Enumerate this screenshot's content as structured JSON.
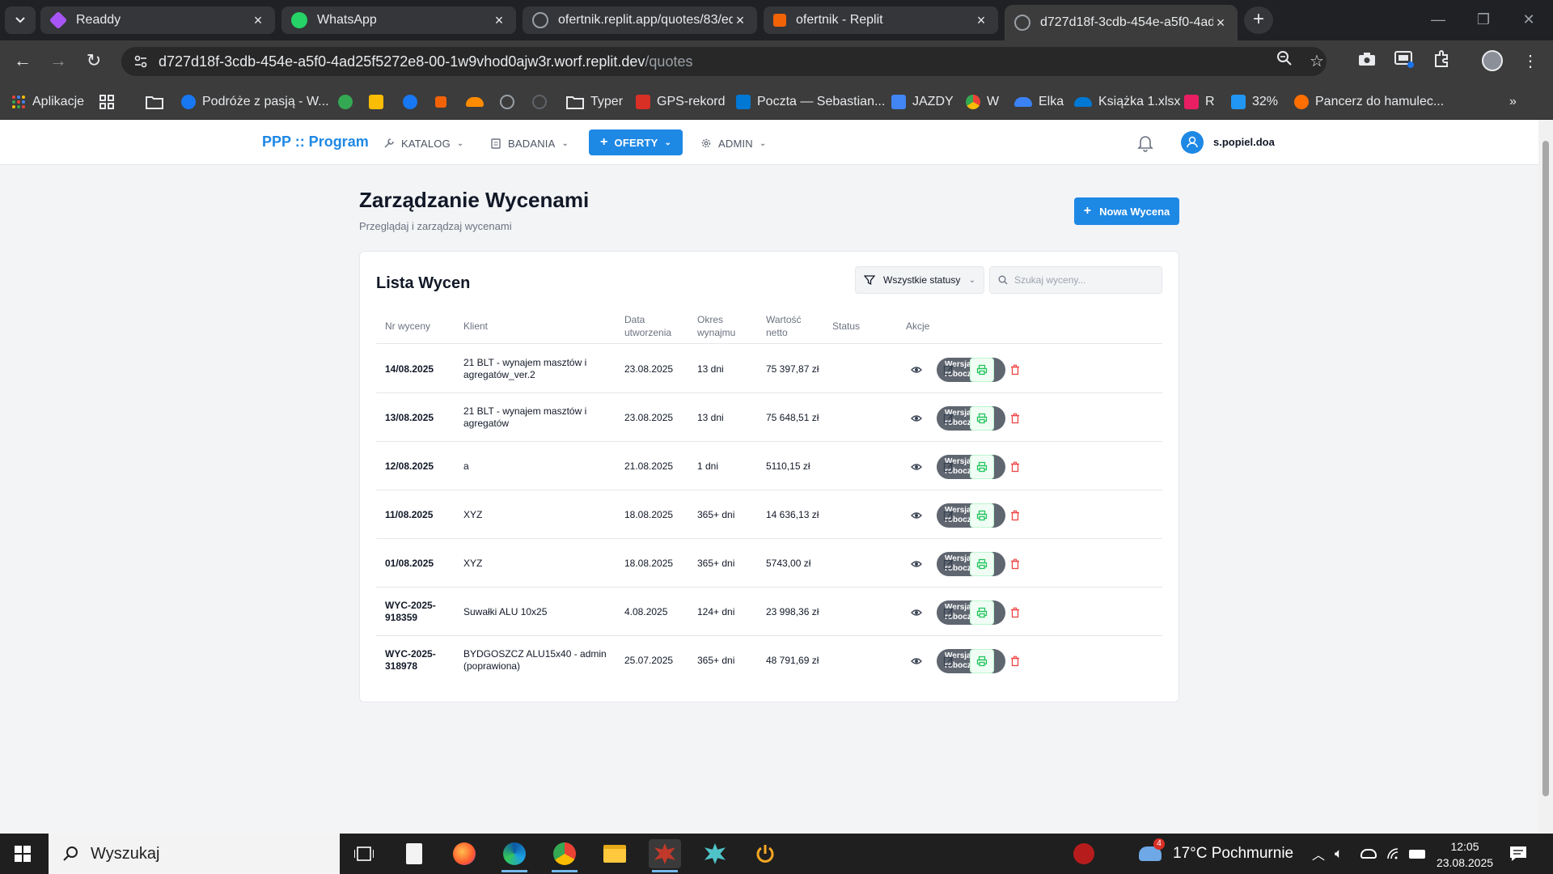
{
  "browser": {
    "tabs": [
      {
        "title": "Readdy",
        "favicon_color": "#a855f7"
      },
      {
        "title": "WhatsApp",
        "favicon_color": "#25d366"
      },
      {
        "title": "ofertnik.replit.app/quotes/83/ed",
        "favicon_color": "#9aa0a6"
      },
      {
        "title": "ofertnik - Replit",
        "favicon_color": "#f26207"
      },
      {
        "title": "d727d18f-3cdb-454e-a5f0-4ad",
        "favicon_color": "#9aa0a6"
      }
    ],
    "url_host": "d727d18f-3cdb-454e-a5f0-4ad25f5272e8-00-1w9vhod0ajw3r.worf.replit.dev",
    "url_path": "/quotes",
    "bookmarks": [
      {
        "label": "Aplikacje",
        "color": "#ea4335"
      },
      {
        "label": "",
        "color": "#9aa0a6"
      },
      {
        "label": "",
        "color": "#9aa0a6"
      },
      {
        "label": "Podróże z pasją - W...",
        "color": "#1877f2"
      },
      {
        "label": "",
        "color": "#34a853"
      },
      {
        "label": "",
        "color": "#fbbc04"
      },
      {
        "label": "",
        "color": "#1877f2"
      },
      {
        "label": "",
        "color": "#f26207"
      },
      {
        "label": "",
        "color": "#ff8c00"
      },
      {
        "label": "",
        "color": "#9aa0a6"
      },
      {
        "label": "",
        "color": "#5f6368"
      },
      {
        "label": "Typer",
        "color": "#9aa0a6"
      },
      {
        "label": "GPS-rekord",
        "color": "#d93025"
      },
      {
        "label": "Poczta — Sebastian...",
        "color": "#0078d4"
      },
      {
        "label": "JAZDY",
        "color": "#4285f4"
      },
      {
        "label": "W",
        "color": "#fbbc04"
      },
      {
        "label": "Elka",
        "color": "#0f9d58"
      },
      {
        "label": "Książka 1.xlsx",
        "color": "#0078d4"
      },
      {
        "label": "R",
        "color": "#e91e63"
      },
      {
        "label": "32%",
        "color": "#2196f3"
      },
      {
        "label": "Pancerz do hamulec...",
        "color": "#ff6f00"
      }
    ]
  },
  "app": {
    "brand": "PPP :: Program",
    "nav": [
      {
        "label": "KATALOG"
      },
      {
        "label": "BADANIA"
      },
      {
        "label": "OFERTY"
      },
      {
        "label": "ADMIN"
      }
    ],
    "user": "s.popiel.doa"
  },
  "page": {
    "title": "Zarządzanie Wycenami",
    "subtitle": "Przeglądaj i zarządzaj wycenami",
    "new_button": "Nowa Wycena"
  },
  "list": {
    "title": "Lista Wycen",
    "filter_value": "Wszystkie statusy",
    "search_placeholder": "Szukaj wyceny...",
    "columns": [
      "Nr wyceny",
      "Klient",
      "Data utworzenia",
      "Okres wynajmu",
      "Wartość netto",
      "Status",
      "Akcje"
    ],
    "rows": [
      {
        "nr": "14/08.2025",
        "klient": "21 BLT - wynajem masztów i agregatów_ver.2",
        "data": "23.08.2025",
        "okres": "13 dni",
        "wartosc": "75 397,87 zł",
        "status": "Wersja robocza"
      },
      {
        "nr": "13/08.2025",
        "klient": "21 BLT - wynajem masztów i agregatów",
        "data": "23.08.2025",
        "okres": "13 dni",
        "wartosc": "75 648,51 zł",
        "status": "Wersja robocza"
      },
      {
        "nr": "12/08.2025",
        "klient": "a",
        "data": "21.08.2025",
        "okres": "1 dni",
        "wartosc": "5110,15 zł",
        "status": "Wersja robocza"
      },
      {
        "nr": "11/08.2025",
        "klient": "XYZ",
        "data": "18.08.2025",
        "okres": "365+ dni",
        "wartosc": "14 636,13 zł",
        "status": "Wersja robocza"
      },
      {
        "nr": "01/08.2025",
        "klient": "XYZ",
        "data": "18.08.2025",
        "okres": "365+ dni",
        "wartosc": "5743,00 zł",
        "status": "Wersja robocza"
      },
      {
        "nr": "WYC-2025-918359",
        "klient": "Suwałki ALU 10x25",
        "data": "4.08.2025",
        "okres": "124+ dni",
        "wartosc": "23 998,36 zł",
        "status": "Wersja robocza"
      },
      {
        "nr": "WYC-2025-318978",
        "klient": "BYDGOSZCZ ALU15x40 - admin (poprawiona)",
        "data": "25.07.2025",
        "okres": "365+ dni",
        "wartosc": "48 791,69 zł",
        "status": "Wersja robocza"
      }
    ]
  },
  "taskbar": {
    "search_placeholder": "Wyszukaj",
    "weather_badge": "4",
    "weather": "17°C Pochmurnie",
    "time": "12:05",
    "date": "23.08.2025"
  },
  "colors": {
    "accent": "#1e88e5",
    "status_badge": "#5f6670",
    "delete": "#ef4444",
    "print": "#22c55e"
  }
}
